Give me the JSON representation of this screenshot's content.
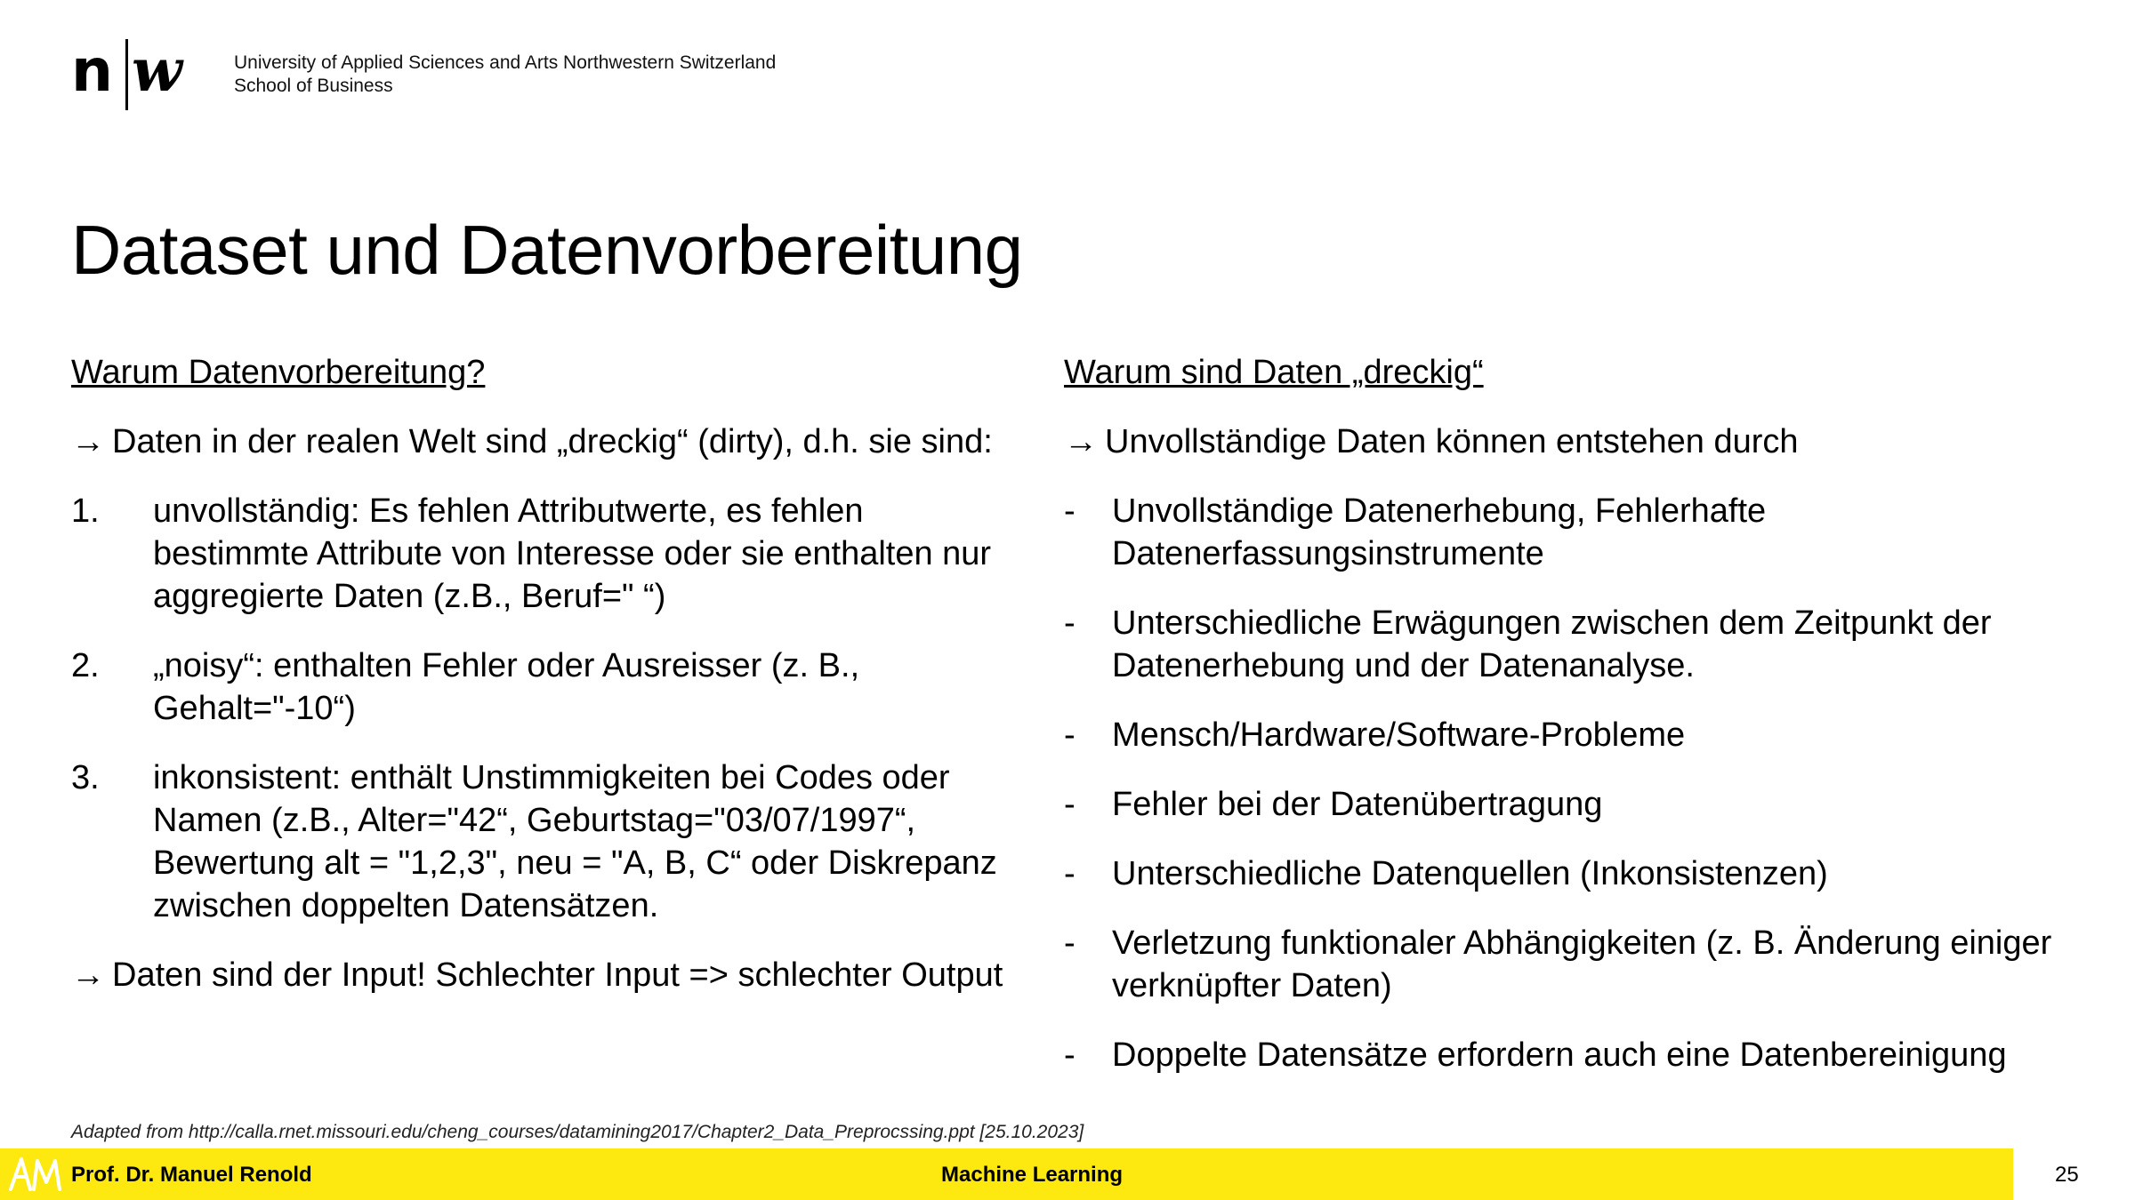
{
  "header": {
    "institution_line1": "University of Applied Sciences and Arts Northwestern Switzerland",
    "institution_line2": "School of Business",
    "logo_letter_left": "n",
    "logo_letter_right": "w"
  },
  "title": "Dataset und Datenvorbereitung",
  "left": {
    "heading": "Warum Datenvorbereitung?",
    "arrow_glyph": "→",
    "intro": "Daten in der realen Welt sind „dreckig“ (dirty), d.h. sie sind:",
    "items": [
      {
        "marker": "1.",
        "text": "unvollständig: Es fehlen Attributwerte, es fehlen bestimmte Attribute von Interesse oder sie enthalten nur aggregierte Daten (z.B., Beruf=\" “)"
      },
      {
        "marker": "2.",
        "text": "„noisy“: enthalten Fehler oder Ausreisser (z. B., Gehalt=\"-10“)"
      },
      {
        "marker": "3.",
        "text": "inkonsistent: enthält Unstimmigkeiten bei Codes oder Namen (z.B., Alter=\"42“, Geburtstag=\"03/07/1997“, Bewertung alt = \"1,2,3\", neu = \"A, B, C“ oder Diskrepanz zwischen doppelten Datensätzen."
      }
    ],
    "conclusion": "Daten sind der Input! Schlechter Input => schlechter Output"
  },
  "right": {
    "heading": "Warum sind Daten „dreckig“",
    "arrow_glyph": "→",
    "intro": "Unvollständige Daten können entstehen durch",
    "items": [
      {
        "marker": "-",
        "text": "Unvollständige Datenerhebung, Fehlerhafte Datenerfassungsinstrumente"
      },
      {
        "marker": "-",
        "text": "Unterschiedliche Erwägungen zwischen dem Zeitpunkt der Datenerhebung und der Datenanalyse."
      },
      {
        "marker": "-",
        "text": "Mensch/Hardware/Software-Probleme"
      },
      {
        "marker": "-",
        "text": "Fehler bei der Datenübertragung"
      },
      {
        "marker": "-",
        "text": "Unterschiedliche Datenquellen (Inkonsistenzen)"
      },
      {
        "marker": "-",
        "text": "Verletzung funktionaler Abhängigkeiten (z. B. Änderung einiger verknüpfter Daten)"
      },
      {
        "marker": "-",
        "text": "Doppelte Datensätze erfordern auch eine Datenbereinigung"
      }
    ]
  },
  "source": "Adapted from http://calla.rnet.missouri.edu/cheng_courses/datamining2017/Chapter2_Data_Preprocssing.ppt [25.10.2023]",
  "footer": {
    "author": "Prof. Dr. Manuel Renold",
    "course": "Machine Learning",
    "page_number": "25",
    "bar_color": "#fde910"
  }
}
